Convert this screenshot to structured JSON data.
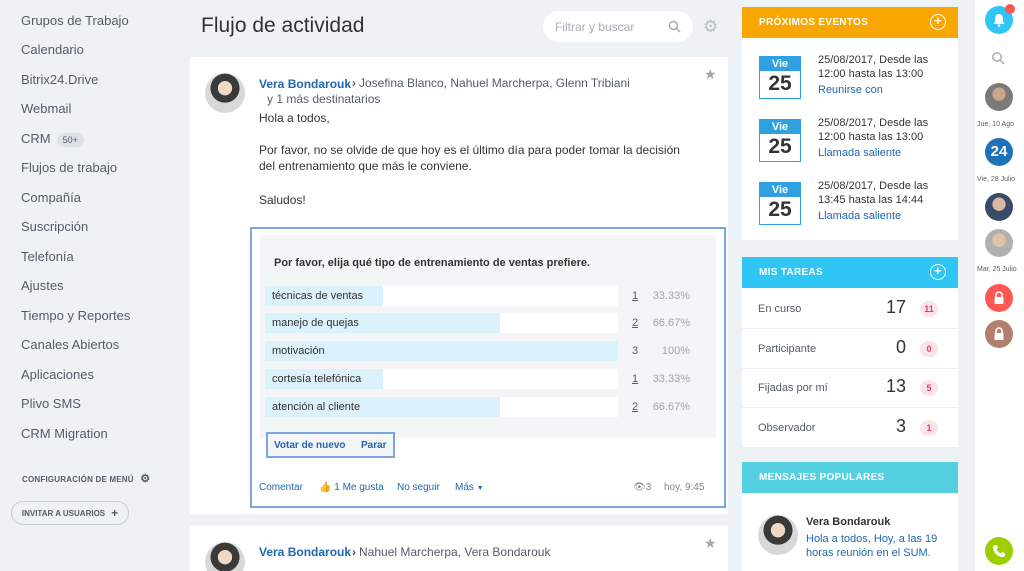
{
  "left_menu": {
    "items": [
      "Grupos de Trabajo",
      "Calendario",
      "Bitrix24.Drive",
      "Webmail",
      "CRM",
      "Flujos de trabajo",
      "Compañía",
      "Suscripción",
      "Telefonía",
      "Ajustes",
      "Tiempo y Reportes",
      "Canales Abiertos",
      "Aplicaciones",
      "Plivo SMS",
      "CRM Migration"
    ],
    "crm_badge": "50+",
    "config_label": "CONFIGURACIÓN DE MENÚ",
    "invite_label": "INVITAR A USUARIOS"
  },
  "header": {
    "title": "Flujo de actividad",
    "search_placeholder": "Filtrar y buscar"
  },
  "post1": {
    "author": "Vera Bondarouk",
    "recipients": "Josefina Blanco, Nahuel Marcherpa, Glenn Tribiani",
    "more_recipients": "y 1 más destinatarios",
    "greeting": "Hola a todos,",
    "body": "Por favor, no se olvide de que hoy es el último día para poder tomar la decisión del entrenamiento que más le conviene.",
    "closing": "Saludos!",
    "poll": {
      "question": "Por favor, elija qué tipo de entrenamiento de ventas prefiere.",
      "options": [
        {
          "label": "técnicas de ventas",
          "count": "1",
          "percent": "33.33%",
          "fraction": 0.3333
        },
        {
          "label": "manejo de quejas",
          "count": "2",
          "percent": "66.67%",
          "fraction": 0.6667
        },
        {
          "label": "motivación",
          "count": "3",
          "percent": "100%",
          "fraction": 1.0
        },
        {
          "label": "cortesía telefónica",
          "count": "1",
          "percent": "33.33%",
          "fraction": 0.3333
        },
        {
          "label": "atención al cliente",
          "count": "2",
          "percent": "66.67%",
          "fraction": 0.6667
        }
      ],
      "vote_again": "Votar de nuevo",
      "stop": "Parar"
    },
    "footer": {
      "comment": "Comentar",
      "like": "1 Me gusta",
      "unfollow": "No seguir",
      "more": "Más",
      "views": "3",
      "time": "hoy, 9:45"
    }
  },
  "post2": {
    "author": "Vera Bondarouk",
    "recipients": "Nahuel Marcherpa, Vera Bondarouk"
  },
  "events": {
    "title": "PRÓXIMOS EVENTOS",
    "color": "#f7a700",
    "items": [
      {
        "day": "Vie",
        "num": "25",
        "time": "25/08/2017, Desde las 12:00 hasta las 13:00",
        "name": "Reunirse con"
      },
      {
        "day": "Vie",
        "num": "25",
        "time": "25/08/2017, Desde las 12:00 hasta las 13:00",
        "name": "Llamada saliente"
      },
      {
        "day": "Vie",
        "num": "25",
        "time": "25/08/2017, Desde las 13:45 hasta las 14:44",
        "name": "Llamada saliente"
      }
    ]
  },
  "tasks": {
    "title": "MIS TAREAS",
    "color": "#2fc6f6",
    "rows": [
      {
        "label": "En curso",
        "count": "17",
        "badge": "11"
      },
      {
        "label": "Participante",
        "count": "0",
        "badge": "0"
      },
      {
        "label": "Fijadas por mí",
        "count": "13",
        "badge": "5"
      },
      {
        "label": "Observador",
        "count": "3",
        "badge": "1"
      }
    ]
  },
  "popular": {
    "title": "MENSAJES POPULARES",
    "color": "#55d0e0",
    "author": "Vera Bondarouk",
    "text": "Hola a todos, Hoy, a las 19 horas reunión en el SUM."
  },
  "strip": {
    "date1": "Jue, 10 Ago",
    "big_num": "24",
    "date2": "Vie, 28 Julio",
    "date3": "Mar, 25 Julio"
  }
}
